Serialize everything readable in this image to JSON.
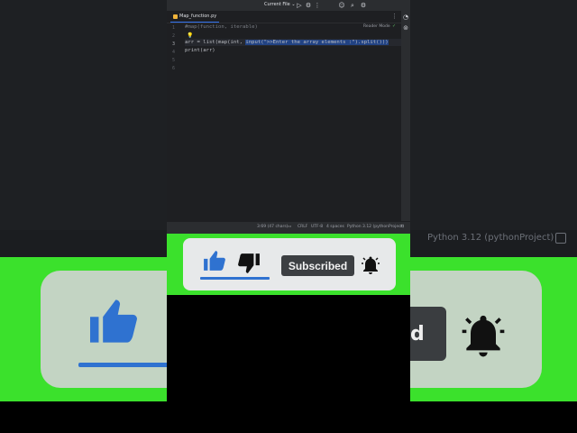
{
  "ide": {
    "run_config": "Current File",
    "tab": {
      "label": "Map_function.py"
    },
    "reader_mode": "Reader Mode",
    "line_numbers": [
      "1",
      "2",
      "3",
      "4",
      "5",
      "6"
    ],
    "code": {
      "line1": "#map(function, iterable)",
      "line3_pre": "arr = list(map(int, ",
      "line3_sel": "input(\">>Enter the array elements :\").split()))",
      "line4": "print(arr)"
    },
    "status": {
      "position": "3:69 (47 chars)",
      "line_ending": "CRLF",
      "encoding": "UTF-8",
      "indent": "4 spaces",
      "interpreter": "Python 3.12 (pythonProject)"
    }
  },
  "background": {
    "status_text": "Python 3.12 (pythonProject)",
    "sub_partial": "d"
  },
  "overlay": {
    "subscribe_label": "Subscribed",
    "accent": "#2f72d0",
    "green": "#3be12c"
  }
}
